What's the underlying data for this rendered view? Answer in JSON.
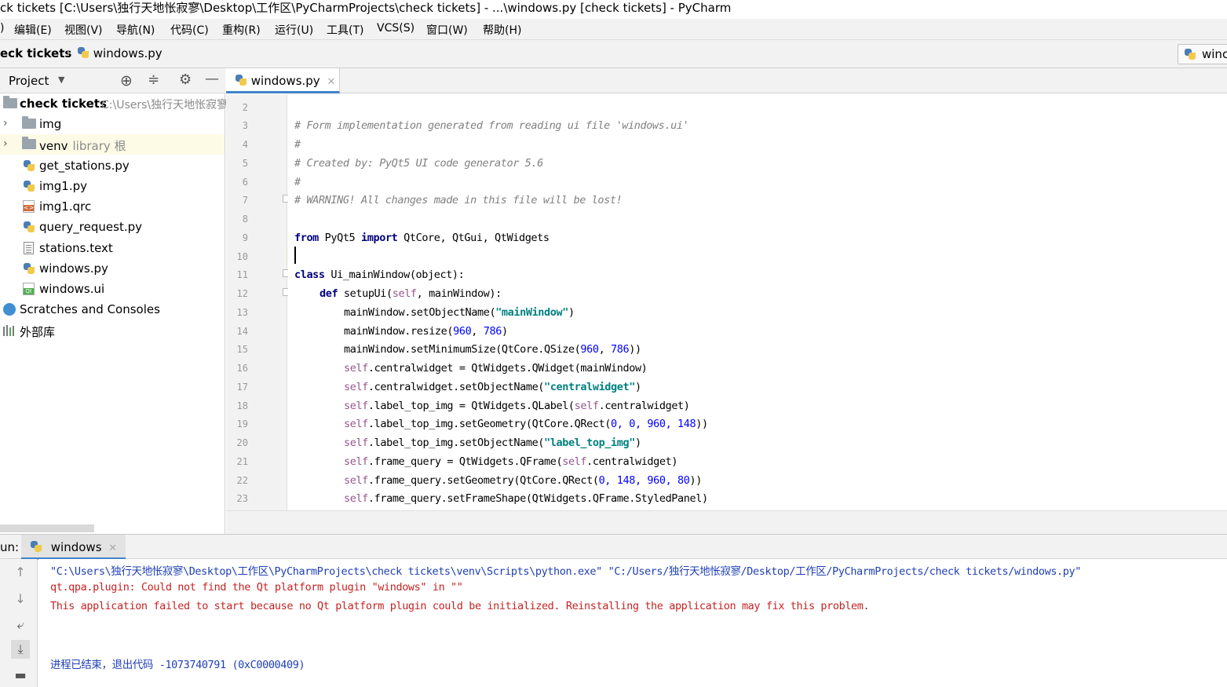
{
  "window": {
    "title": "ck tickets [C:\\Users\\独行天地怅寂寥\\Desktop\\工作区\\PyCharmProjects\\check tickets] - ...\\windows.py [check tickets] - PyCharm"
  },
  "menu": {
    "items": [
      "编辑(E)",
      "视图(V)",
      "导航(N)",
      "代码(C)",
      "重构(R)",
      "运行(U)",
      "工具(T)",
      "VCS(S)",
      "窗口(W)",
      "帮助(H)"
    ],
    "first_partial": ")"
  },
  "navbar": {
    "project": "eck tickets",
    "file": "windows.py",
    "run_config": "winc"
  },
  "project_panel": {
    "header_label": "Project",
    "root": {
      "name": "check tickets",
      "path": "C:\\Users\\独行天地怅寂寥"
    },
    "items": [
      {
        "name": "img",
        "type": "folder"
      },
      {
        "name": "venv",
        "sub": "library 根",
        "type": "folder"
      },
      {
        "name": "get_stations.py",
        "type": "py"
      },
      {
        "name": "img1.py",
        "type": "py"
      },
      {
        "name": "img1.qrc",
        "type": "qrc"
      },
      {
        "name": "query_request.py",
        "type": "py"
      },
      {
        "name": "stations.text",
        "type": "txt"
      },
      {
        "name": "windows.py",
        "type": "py"
      },
      {
        "name": "windows.ui",
        "type": "ui"
      }
    ],
    "scratches": "Scratches and Consoles",
    "external_libs": "外部库"
  },
  "editor": {
    "tab_label": "windows.py",
    "line_numbers": [
      "2",
      "3",
      "4",
      "5",
      "6",
      "7",
      "8",
      "9",
      "10",
      "11",
      "12",
      "13",
      "14",
      "15",
      "16",
      "17",
      "18",
      "19",
      "20",
      "21",
      "22",
      "23"
    ],
    "lines": {
      "l3": "# Form implementation generated from reading ui file 'windows.ui'",
      "l4": "#",
      "l5": "# Created by: PyQt5 UI code generator 5.6",
      "l6": "#",
      "l7": "# WARNING! All changes made in this file will be lost!",
      "l9_kw1": "from",
      "l9_mid": " PyQt5 ",
      "l9_kw2": "import",
      "l9_rest": " QtCore, QtGui, QtWidgets",
      "l11_kw": "class",
      "l11_rest": " Ui_mainWindow(object):",
      "l12_kw": "def",
      "l12_name": " setupUi(",
      "l12_self": "self",
      "l12_rest": ", mainWindow):",
      "l13_a": "mainWindow.setObjectName(",
      "l13_s": "\"mainWindow\"",
      "l13_b": ")",
      "l14_a": "mainWindow.resize(",
      "l14_n1": "960",
      "l14_c": ", ",
      "l14_n2": "786",
      "l14_b": ")",
      "l15_a": "mainWindow.setMinimumSize(QtCore.QSize(",
      "l15_n1": "960",
      "l15_c": ", ",
      "l15_n2": "786",
      "l15_b": "))",
      "l16_self": "self",
      "l16_rest": ".centralwidget = QtWidgets.QWidget(mainWindow)",
      "l17_self": "self",
      "l17_a": ".centralwidget.setObjectName(",
      "l17_s": "\"centralwidget\"",
      "l17_b": ")",
      "l18_self": "self",
      "l18_a": ".label_top_img = QtWidgets.QLabel(",
      "l18_self2": "self",
      "l18_b": ".centralwidget)",
      "l19_self": "self",
      "l19_a": ".label_top_img.setGeometry(QtCore.QRect(",
      "l19_n": "0, 0, 960, 148",
      "l19_b": "))",
      "l20_self": "self",
      "l20_a": ".label_top_img.setObjectName(",
      "l20_s": "\"label_top_img\"",
      "l20_b": ")",
      "l21_self": "self",
      "l21_a": ".frame_query = QtWidgets.QFrame(",
      "l21_self2": "self",
      "l21_b": ".centralwidget)",
      "l22_self": "self",
      "l22_a": ".frame_query.setGeometry(QtCore.QRect(",
      "l22_n": "0, 148, 960, 80",
      "l22_b": "))",
      "l23_self": "self",
      "l23_rest": ".frame_query.setFrameShape(QtWidgets.QFrame.StyledPanel)"
    }
  },
  "run_panel": {
    "label": "un:",
    "tab_label": "windows",
    "lines": {
      "cmd": "\"C:\\Users\\独行天地怅寂寥\\Desktop\\工作区\\PyCharmProjects\\check tickets\\venv\\Scripts\\python.exe\" \"C:/Users/独行天地怅寂寥/Desktop/工作区/PyCharmProjects/check tickets/windows.py\"",
      "err1": "qt.qpa.plugin: Could not find the Qt platform plugin \"windows\" in \"\"",
      "err2": "This application failed to start because no Qt platform plugin could be initialized. Reinstalling the application may fix this problem.",
      "exit": "进程已结束，退出代码 -1073740791 (0xC0000409)"
    }
  },
  "colors": {
    "accent": "#4083c9",
    "keyword": "#000080",
    "string": "#008080",
    "number": "#0000ff",
    "self": "#94558d",
    "comment": "#808080",
    "error": "#c42323"
  }
}
